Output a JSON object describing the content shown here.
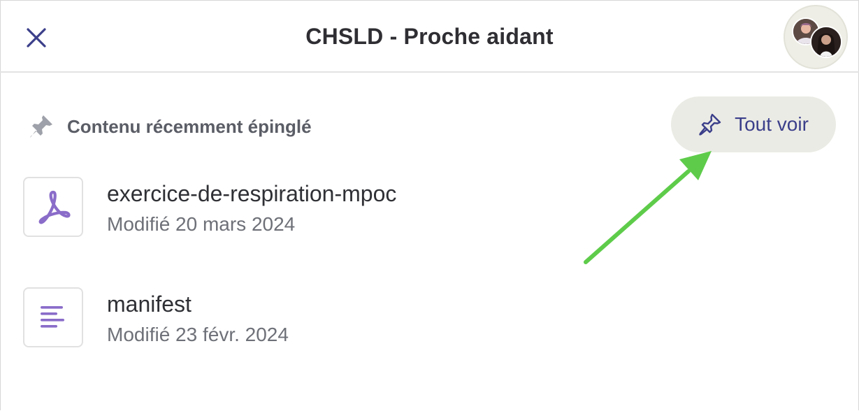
{
  "header": {
    "title": "CHSLD - Proche aidant"
  },
  "icons": {
    "close": "close-icon",
    "pin": "pin-icon",
    "pin_outline": "pin-outline-icon",
    "pdf": "pdf-icon",
    "document": "document-lines-icon"
  },
  "colors": {
    "title": "#2e2e33",
    "accent": "#3b3f8a",
    "file_icon": "#8a6cc9",
    "pill_bg": "#ebebe5",
    "annotation_arrow": "#5ecc4a"
  },
  "pinned": {
    "section_title": "Contenu récemment épinglé",
    "see_all_label": "Tout voir",
    "files": [
      {
        "name": "exercice-de-respiration-mpoc",
        "meta": "Modifié 20 mars 2024",
        "icon": "pdf-icon"
      },
      {
        "name": "manifest",
        "meta": "Modifié 23 févr. 2024",
        "icon": "document-lines-icon"
      }
    ]
  }
}
